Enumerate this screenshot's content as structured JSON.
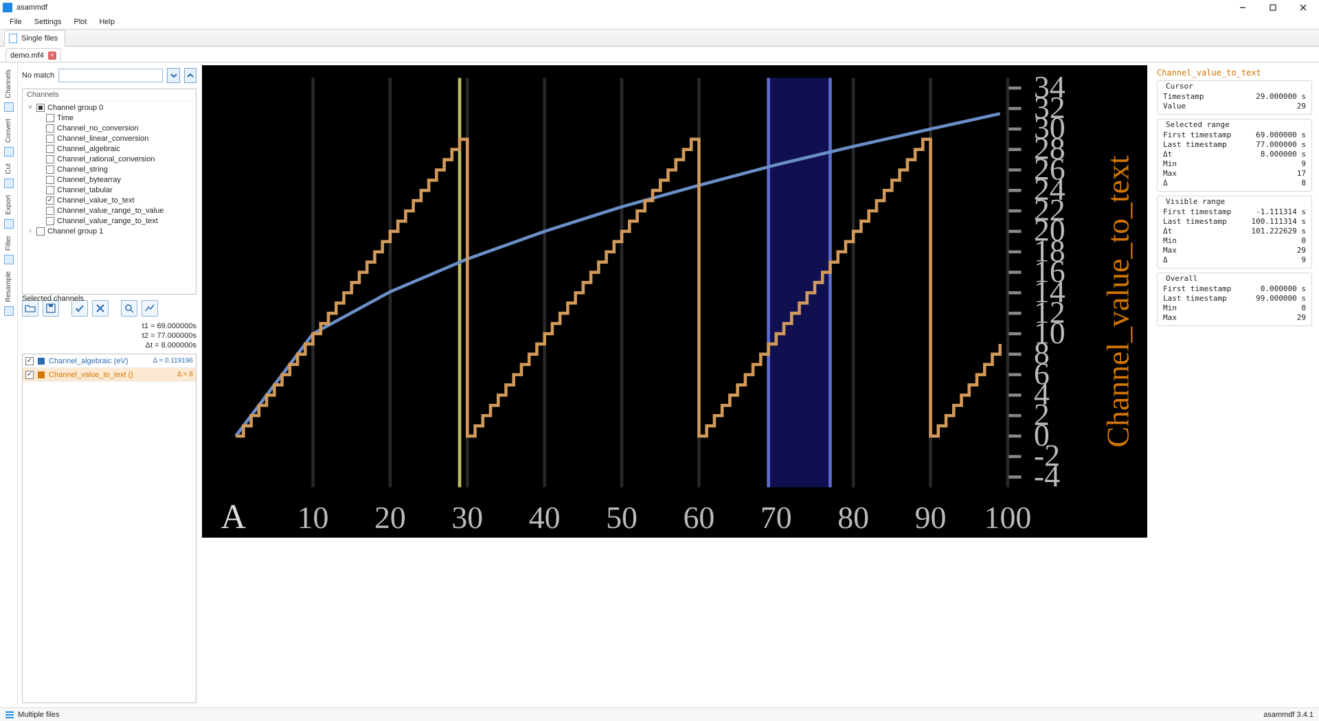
{
  "window": {
    "title": "asammdf"
  },
  "menu": {
    "file": "File",
    "settings": "Settings",
    "plot": "Plot",
    "help": "Help"
  },
  "mode_tab": "Single files",
  "file_tab": "demo.mf4",
  "vside_tabs": [
    "Channels",
    "Convert",
    "Cut",
    "Export",
    "Filter",
    "Resample"
  ],
  "search": {
    "label": "No match",
    "value": ""
  },
  "tree": {
    "header": "Channels",
    "group0": "Channel group 0",
    "items0": [
      "Time",
      "Channel_no_conversion",
      "Channel_linear_conversion",
      "Channel_algebraic",
      "Channel_rational_conversion",
      "Channel_string",
      "Channel_bytearray",
      "Channel_tabular",
      "Channel_value_to_text",
      "Channel_value_range_to_value",
      "Channel_value_range_to_text"
    ],
    "checked_idx": 8,
    "group1": "Channel group 1"
  },
  "timestats": {
    "t1": "t1 = 69.000000s",
    "t2": "t2 = 77.000000s",
    "dt": "Δt = 8.000000s"
  },
  "selchans_label": "Selected channels",
  "selected": [
    {
      "name": "Channel_algebraic (eV)",
      "delta": "Δ = 0.119196",
      "color": "#2b6cb0"
    },
    {
      "name": "Channel_value_to_text ()",
      "delta": "Δ = 8",
      "color": "#d27400"
    }
  ],
  "right": {
    "title": "Channel_value_to_text",
    "groups": [
      {
        "title": "Cursor",
        "rows": [
          [
            "Timestamp",
            "29.000000 s"
          ],
          [
            "Value",
            "29"
          ]
        ]
      },
      {
        "title": "Selected range",
        "rows": [
          [
            "First timestamp",
            "69.000000 s"
          ],
          [
            "Last timestamp",
            "77.000000 s"
          ],
          [
            "Δt",
            "8.000000 s"
          ],
          [
            "Min",
            "9"
          ],
          [
            "Max",
            "17"
          ],
          [
            "Δ",
            "8"
          ]
        ]
      },
      {
        "title": "Visible range",
        "rows": [
          [
            "First timestamp",
            "-1.111314 s"
          ],
          [
            "Last timestamp",
            "100.111314 s"
          ],
          [
            "Δt",
            "101.222629 s"
          ],
          [
            "Min",
            "0"
          ],
          [
            "Max",
            "29"
          ],
          [
            "Δ",
            "9"
          ]
        ]
      },
      {
        "title": "Overall",
        "rows": [
          [
            "First timestamp",
            "0.000000 s"
          ],
          [
            "Last timestamp",
            "99.000000 s"
          ],
          [
            "Min",
            "0"
          ],
          [
            "Max",
            "29"
          ]
        ]
      }
    ]
  },
  "statusbar": {
    "mode": "Multiple files",
    "version": "asammdf 3.4.1"
  },
  "chart_data": {
    "type": "line",
    "xlabel": "",
    "ylabel": "Channel_value_to_text",
    "xlim": [
      -1.111314,
      100.111314
    ],
    "ylim": [
      -5,
      35
    ],
    "x_ticks": [
      10,
      20,
      30,
      40,
      50,
      60,
      70,
      80,
      90,
      100
    ],
    "y_ticks": [
      -4,
      -2,
      0,
      2,
      4,
      6,
      8,
      10,
      12,
      14,
      16,
      18,
      20,
      22,
      24,
      26,
      28,
      30,
      32,
      34
    ],
    "cursor_x": 29,
    "selection_x": [
      69,
      77
    ],
    "series": [
      {
        "name": "Channel_algebraic",
        "color": "#6a8fc8",
        "shape": "smooth",
        "x": [
          0,
          10,
          20,
          30,
          40,
          50,
          60,
          70,
          80,
          90,
          99
        ],
        "values": [
          0,
          10,
          14.1,
          17.3,
          20,
          22.4,
          24.5,
          26.5,
          28.3,
          30,
          31.5
        ]
      },
      {
        "name": "Channel_value_to_text",
        "color": "#d29a5a",
        "shape": "step",
        "period": 30,
        "x": [
          0,
          1,
          2,
          3,
          4,
          5,
          6,
          7,
          8,
          9,
          10,
          11,
          12,
          13,
          14,
          15,
          16,
          17,
          18,
          19,
          20,
          21,
          22,
          23,
          24,
          25,
          26,
          27,
          28,
          29,
          30,
          31,
          32,
          33,
          34,
          35,
          36,
          37,
          38,
          39,
          40,
          41,
          42,
          43,
          44,
          45,
          46,
          47,
          48,
          49,
          50,
          51,
          52,
          53,
          54,
          55,
          56,
          57,
          58,
          59,
          60,
          61,
          62,
          63,
          64,
          65,
          66,
          67,
          68,
          69,
          70,
          71,
          72,
          73,
          74,
          75,
          76,
          77,
          78,
          79,
          80,
          81,
          82,
          83,
          84,
          85,
          86,
          87,
          88,
          89,
          90,
          91,
          92,
          93,
          94,
          95,
          96,
          97,
          98,
          99
        ],
        "values": [
          0,
          1,
          2,
          3,
          4,
          5,
          6,
          7,
          8,
          9,
          10,
          11,
          12,
          13,
          14,
          15,
          16,
          17,
          18,
          19,
          20,
          21,
          22,
          23,
          24,
          25,
          26,
          27,
          28,
          29,
          0,
          1,
          2,
          3,
          4,
          5,
          6,
          7,
          8,
          9,
          10,
          11,
          12,
          13,
          14,
          15,
          16,
          17,
          18,
          19,
          20,
          21,
          22,
          23,
          24,
          25,
          26,
          27,
          28,
          29,
          0,
          1,
          2,
          3,
          4,
          5,
          6,
          7,
          8,
          9,
          10,
          11,
          12,
          13,
          14,
          15,
          16,
          17,
          18,
          19,
          20,
          21,
          22,
          23,
          24,
          25,
          26,
          27,
          28,
          29,
          0,
          1,
          2,
          3,
          4,
          5,
          6,
          7,
          8,
          9
        ]
      }
    ]
  }
}
